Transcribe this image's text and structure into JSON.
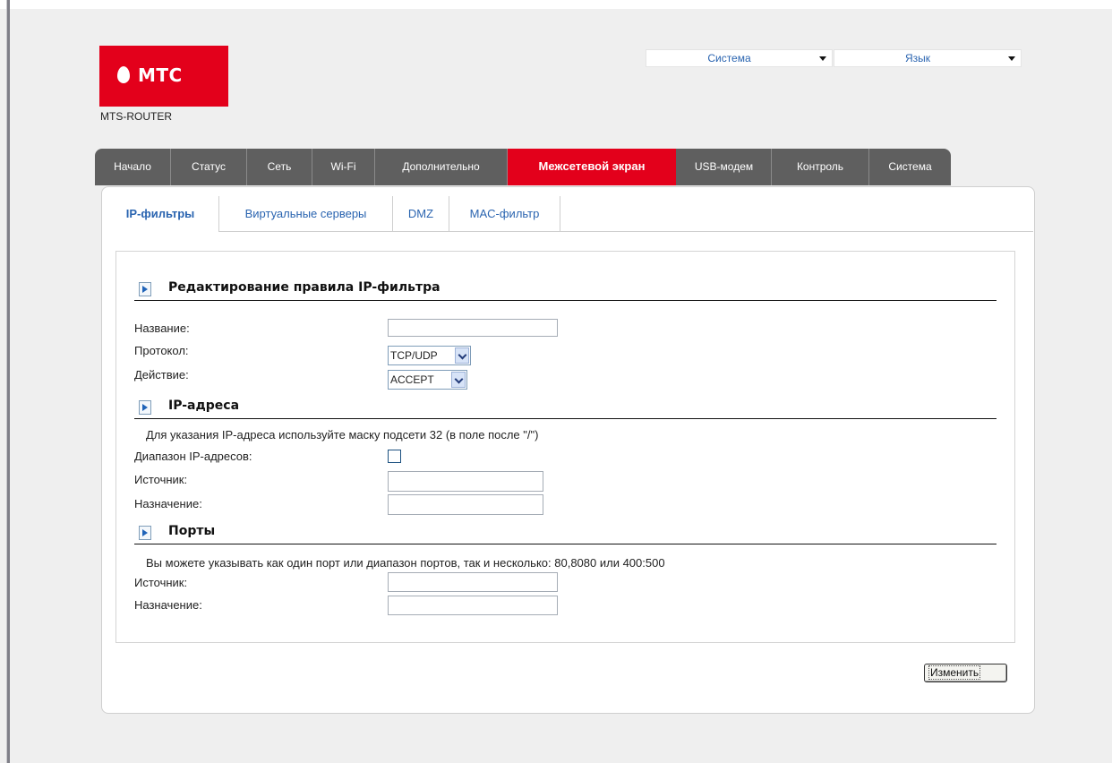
{
  "logo": {
    "brand": "МТС",
    "brand_color": "#e3001b"
  },
  "model": "MTS-ROUTER",
  "top_menu": {
    "system": "Система",
    "language": "Язык"
  },
  "main_nav": {
    "tabs": [
      {
        "label": "Начало"
      },
      {
        "label": "Статус"
      },
      {
        "label": "Сеть"
      },
      {
        "label": "Wi-Fi"
      },
      {
        "label": "Дополнительно"
      },
      {
        "label": "Межсетевой экран",
        "active": true
      },
      {
        "label": "USB-модем"
      },
      {
        "label": "Контроль"
      },
      {
        "label": "Система"
      }
    ]
  },
  "sub_nav": {
    "tabs": [
      {
        "label": "IP-фильтры",
        "active": true
      },
      {
        "label": "Виртуальные серверы"
      },
      {
        "label": "DMZ"
      },
      {
        "label": "MAC-фильтр"
      }
    ]
  },
  "sections": {
    "rule": {
      "title": "Редактирование правила IP-фильтра"
    },
    "ip": {
      "title": "IP-адреса",
      "note": "Для указания IP-адреса используйте маску подсети 32 (в поле после \"/\")"
    },
    "ports": {
      "title": "Порты",
      "note": "Вы можете указывать как один порт или диапазон портов, так и несколько: 80,8080 или 400:500"
    }
  },
  "form": {
    "name_label": "Название:",
    "name_value": "",
    "protocol_label": "Протокол:",
    "protocol_value": "TCP/UDP",
    "action_label": "Действие:",
    "action_value": "ACCEPT",
    "range_label": "Диапазон IP-адресов:",
    "range_checked": false,
    "ip_source_label": "Источник:",
    "ip_source_value": "",
    "ip_dest_label": "Назначение:",
    "ip_dest_value": "",
    "port_source_label": "Источник:",
    "port_source_value": "",
    "port_dest_label": "Назначение:",
    "port_dest_value": ""
  },
  "actions": {
    "change_label": "Изменить"
  }
}
